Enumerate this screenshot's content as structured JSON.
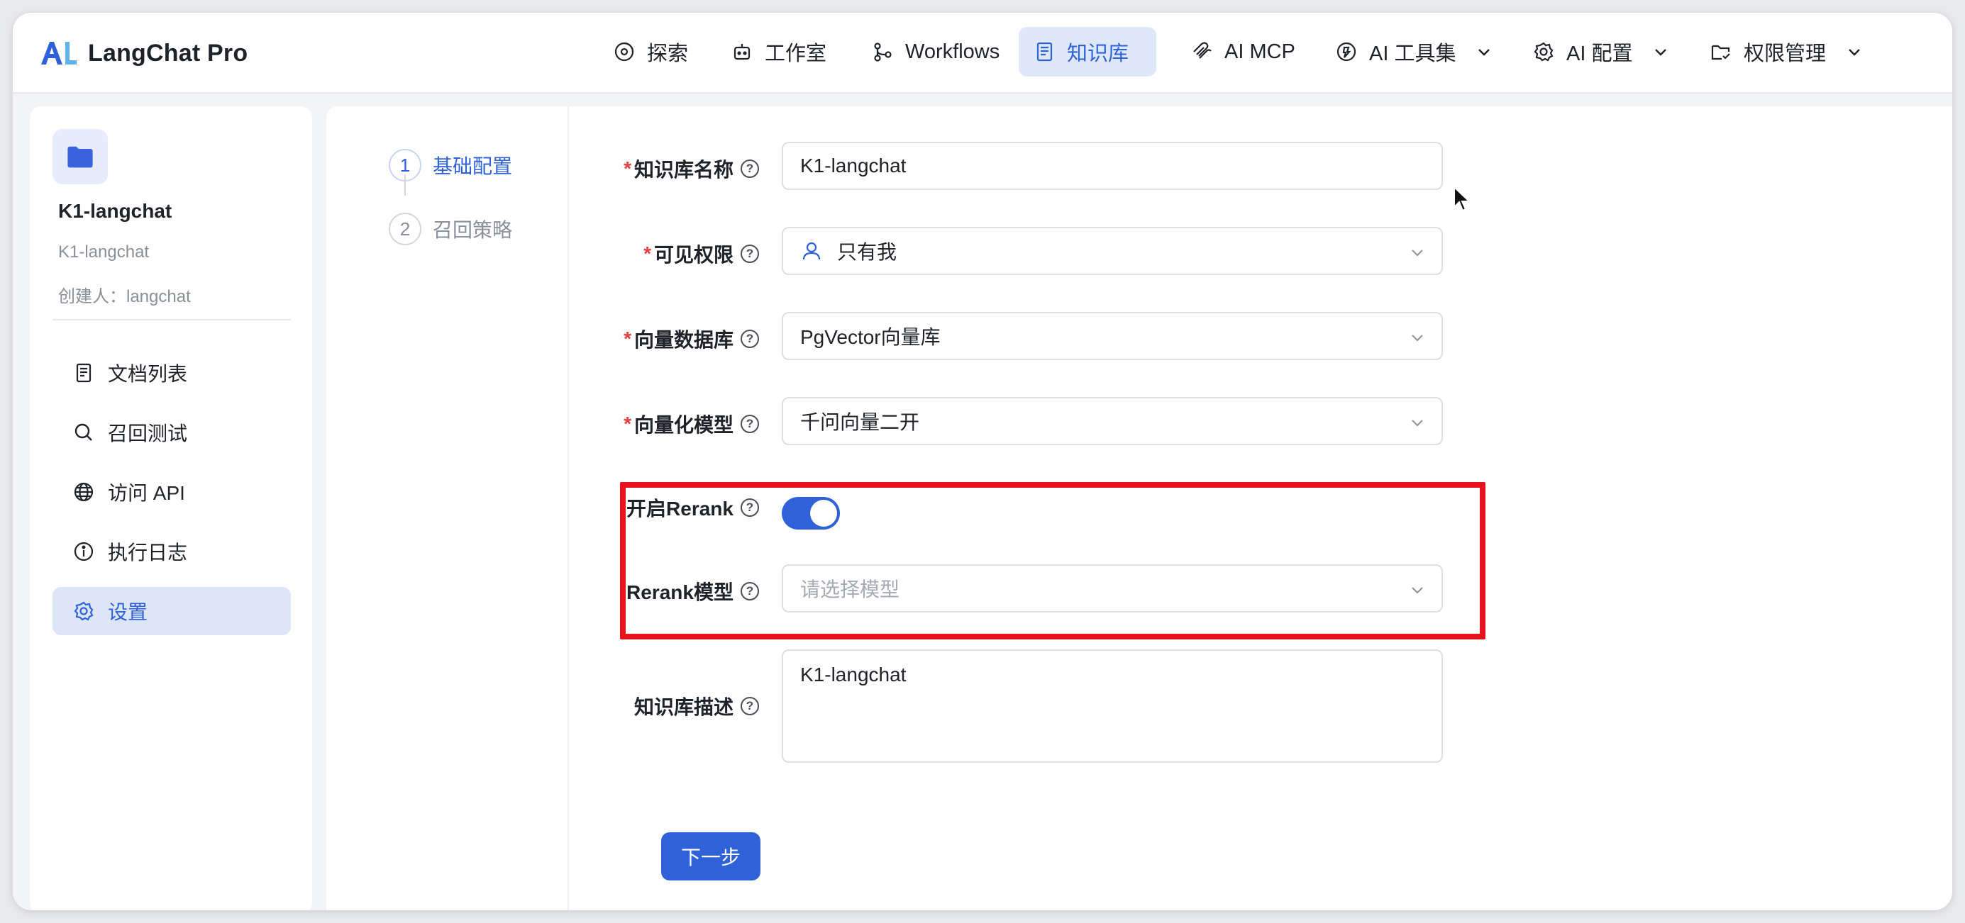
{
  "app": {
    "name": "LangChat Pro"
  },
  "nav": {
    "items": [
      {
        "label": "探索",
        "icon": "explore-icon"
      },
      {
        "label": "工作室",
        "icon": "robot-icon"
      },
      {
        "label": "Workflows",
        "icon": "workflow-icon"
      },
      {
        "label": "知识库",
        "icon": "book-icon",
        "active": true
      },
      {
        "label": "AI MCP",
        "icon": "mcp-icon"
      },
      {
        "label": "AI 工具集",
        "icon": "toolkit-icon",
        "dropdown": true
      },
      {
        "label": "AI 配置",
        "icon": "gear-icon",
        "dropdown": true
      },
      {
        "label": "权限管理",
        "icon": "folder-permission-icon",
        "dropdown": true
      }
    ]
  },
  "sidebar": {
    "kb_name": "K1-langchat",
    "kb_sub": "K1-langchat",
    "creator": "创建人：langchat",
    "items": [
      {
        "label": "文档列表",
        "icon": "document-icon"
      },
      {
        "label": "召回测试",
        "icon": "search-icon"
      },
      {
        "label": "访问 API",
        "icon": "globe-icon"
      },
      {
        "label": "执行日志",
        "icon": "info-icon"
      },
      {
        "label": "设置",
        "icon": "gear-icon",
        "active": true
      }
    ]
  },
  "steps": [
    {
      "num": "1",
      "label": "基础配置",
      "active": true
    },
    {
      "num": "2",
      "label": "召回策略",
      "active": false
    }
  ],
  "form": {
    "name": {
      "label": "知识库名称",
      "required": true,
      "value": "K1-langchat"
    },
    "visibility": {
      "label": "可见权限",
      "required": true,
      "value": "只有我"
    },
    "vector_db": {
      "label": "向量数据库",
      "required": true,
      "value": "PgVector向量库"
    },
    "embed_model": {
      "label": "向量化模型",
      "required": true,
      "value": "千问向量二开"
    },
    "rerank_enable": {
      "label": "开启Rerank",
      "required": false,
      "on": true
    },
    "rerank_model": {
      "label": "Rerank模型",
      "required": false,
      "placeholder": "请选择模型"
    },
    "description": {
      "label": "知识库描述",
      "required": false,
      "value": "K1-langchat"
    },
    "next_label": "下一步"
  },
  "colors": {
    "primary": "#2f62d8",
    "active_bg": "#dfe8f9",
    "required": "#e23c3c",
    "highlight": "#e8121c"
  }
}
